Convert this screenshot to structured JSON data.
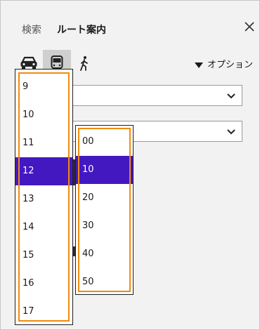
{
  "tabs": {
    "search": "検索",
    "route": "ルート案内"
  },
  "modes": {
    "car": "car-icon",
    "bus": "bus-icon",
    "walk": "walk-icon"
  },
  "options_label": "オプション",
  "hours": {
    "items": [
      "9",
      "10",
      "11",
      "12",
      "13",
      "14",
      "15",
      "16",
      "17"
    ],
    "selected": "12"
  },
  "minutes": {
    "items": [
      "00",
      "10",
      "20",
      "30",
      "40",
      "50"
    ],
    "selected": "10"
  },
  "colors": {
    "selection": "#4318c0",
    "highlight": "#f08a0e"
  }
}
